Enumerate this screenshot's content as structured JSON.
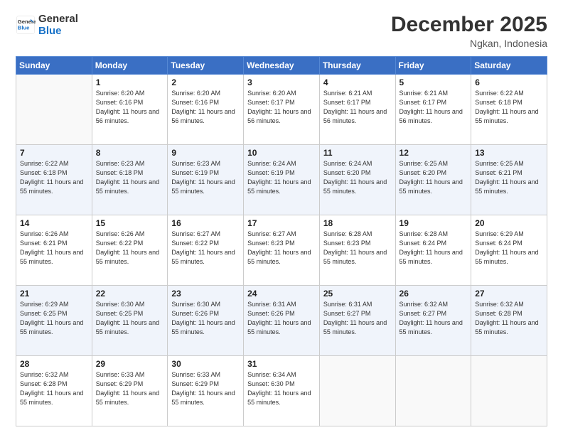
{
  "logo": {
    "line1": "General",
    "line2": "Blue"
  },
  "title": "December 2025",
  "subtitle": "Ngkan, Indonesia",
  "days_of_week": [
    "Sunday",
    "Monday",
    "Tuesday",
    "Wednesday",
    "Thursday",
    "Friday",
    "Saturday"
  ],
  "weeks": [
    [
      {
        "day": "",
        "info": ""
      },
      {
        "day": "1",
        "info": "Sunrise: 6:20 AM\nSunset: 6:16 PM\nDaylight: 11 hours and 56 minutes."
      },
      {
        "day": "2",
        "info": "Sunrise: 6:20 AM\nSunset: 6:16 PM\nDaylight: 11 hours and 56 minutes."
      },
      {
        "day": "3",
        "info": "Sunrise: 6:20 AM\nSunset: 6:17 PM\nDaylight: 11 hours and 56 minutes."
      },
      {
        "day": "4",
        "info": "Sunrise: 6:21 AM\nSunset: 6:17 PM\nDaylight: 11 hours and 56 minutes."
      },
      {
        "day": "5",
        "info": "Sunrise: 6:21 AM\nSunset: 6:17 PM\nDaylight: 11 hours and 56 minutes."
      },
      {
        "day": "6",
        "info": "Sunrise: 6:22 AM\nSunset: 6:18 PM\nDaylight: 11 hours and 55 minutes."
      }
    ],
    [
      {
        "day": "7",
        "info": "Sunrise: 6:22 AM\nSunset: 6:18 PM\nDaylight: 11 hours and 55 minutes."
      },
      {
        "day": "8",
        "info": "Sunrise: 6:23 AM\nSunset: 6:18 PM\nDaylight: 11 hours and 55 minutes."
      },
      {
        "day": "9",
        "info": "Sunrise: 6:23 AM\nSunset: 6:19 PM\nDaylight: 11 hours and 55 minutes."
      },
      {
        "day": "10",
        "info": "Sunrise: 6:24 AM\nSunset: 6:19 PM\nDaylight: 11 hours and 55 minutes."
      },
      {
        "day": "11",
        "info": "Sunrise: 6:24 AM\nSunset: 6:20 PM\nDaylight: 11 hours and 55 minutes."
      },
      {
        "day": "12",
        "info": "Sunrise: 6:25 AM\nSunset: 6:20 PM\nDaylight: 11 hours and 55 minutes."
      },
      {
        "day": "13",
        "info": "Sunrise: 6:25 AM\nSunset: 6:21 PM\nDaylight: 11 hours and 55 minutes."
      }
    ],
    [
      {
        "day": "14",
        "info": "Sunrise: 6:26 AM\nSunset: 6:21 PM\nDaylight: 11 hours and 55 minutes."
      },
      {
        "day": "15",
        "info": "Sunrise: 6:26 AM\nSunset: 6:22 PM\nDaylight: 11 hours and 55 minutes."
      },
      {
        "day": "16",
        "info": "Sunrise: 6:27 AM\nSunset: 6:22 PM\nDaylight: 11 hours and 55 minutes."
      },
      {
        "day": "17",
        "info": "Sunrise: 6:27 AM\nSunset: 6:23 PM\nDaylight: 11 hours and 55 minutes."
      },
      {
        "day": "18",
        "info": "Sunrise: 6:28 AM\nSunset: 6:23 PM\nDaylight: 11 hours and 55 minutes."
      },
      {
        "day": "19",
        "info": "Sunrise: 6:28 AM\nSunset: 6:24 PM\nDaylight: 11 hours and 55 minutes."
      },
      {
        "day": "20",
        "info": "Sunrise: 6:29 AM\nSunset: 6:24 PM\nDaylight: 11 hours and 55 minutes."
      }
    ],
    [
      {
        "day": "21",
        "info": "Sunrise: 6:29 AM\nSunset: 6:25 PM\nDaylight: 11 hours and 55 minutes."
      },
      {
        "day": "22",
        "info": "Sunrise: 6:30 AM\nSunset: 6:25 PM\nDaylight: 11 hours and 55 minutes."
      },
      {
        "day": "23",
        "info": "Sunrise: 6:30 AM\nSunset: 6:26 PM\nDaylight: 11 hours and 55 minutes."
      },
      {
        "day": "24",
        "info": "Sunrise: 6:31 AM\nSunset: 6:26 PM\nDaylight: 11 hours and 55 minutes."
      },
      {
        "day": "25",
        "info": "Sunrise: 6:31 AM\nSunset: 6:27 PM\nDaylight: 11 hours and 55 minutes."
      },
      {
        "day": "26",
        "info": "Sunrise: 6:32 AM\nSunset: 6:27 PM\nDaylight: 11 hours and 55 minutes."
      },
      {
        "day": "27",
        "info": "Sunrise: 6:32 AM\nSunset: 6:28 PM\nDaylight: 11 hours and 55 minutes."
      }
    ],
    [
      {
        "day": "28",
        "info": "Sunrise: 6:32 AM\nSunset: 6:28 PM\nDaylight: 11 hours and 55 minutes."
      },
      {
        "day": "29",
        "info": "Sunrise: 6:33 AM\nSunset: 6:29 PM\nDaylight: 11 hours and 55 minutes."
      },
      {
        "day": "30",
        "info": "Sunrise: 6:33 AM\nSunset: 6:29 PM\nDaylight: 11 hours and 55 minutes."
      },
      {
        "day": "31",
        "info": "Sunrise: 6:34 AM\nSunset: 6:30 PM\nDaylight: 11 hours and 55 minutes."
      },
      {
        "day": "",
        "info": ""
      },
      {
        "day": "",
        "info": ""
      },
      {
        "day": "",
        "info": ""
      }
    ]
  ]
}
